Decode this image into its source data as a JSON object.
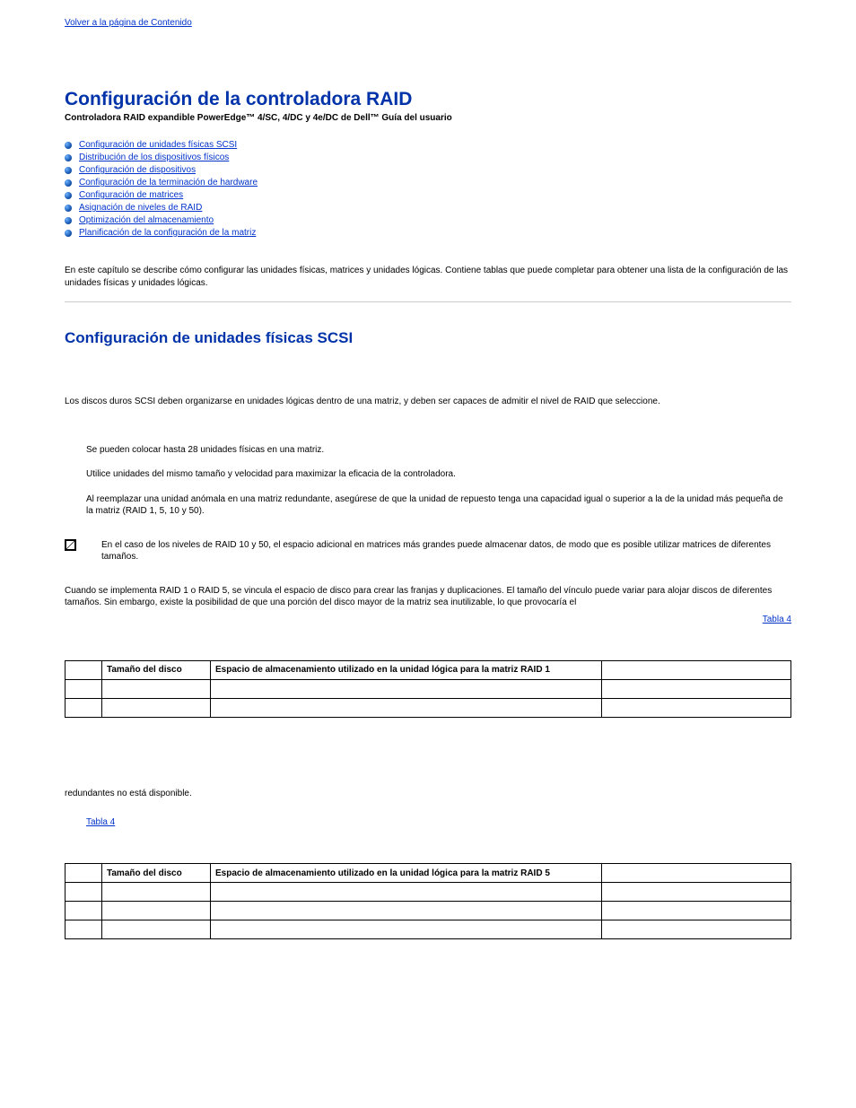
{
  "topLink": "Volver a la página de Contenido",
  "title": "Configuración de la controladora RAID",
  "subtitle": "Controladora RAID expandible PowerEdge™ 4/SC, 4/DC y 4e/DC de Dell™ Guía del usuario",
  "toc": [
    "Configuración de unidades físicas SCSI",
    "Distribución de los dispositivos físicos",
    "Configuración de dispositivos",
    "Configuración de la terminación de hardware",
    "Configuración de matrices",
    "Asignación de niveles de RAID",
    "Optimización del almacenamiento",
    "Planificación de la configuración de la matriz"
  ],
  "intro": "En este capítulo se describe cómo configurar las unidades físicas, matrices y unidades lógicas. Contiene tablas que puede completar para obtener una lista de la configuración de las unidades físicas y unidades lógicas.",
  "section1": {
    "heading": "Configuración de unidades físicas SCSI",
    "p1": "Los discos duros SCSI deben organizarse en unidades lógicas dentro de una matriz, y deben ser capaces de admitir el nivel de RAID que seleccione.",
    "bullets": [
      "Se pueden colocar hasta 28 unidades físicas en una matriz.",
      "Utilice unidades del mismo tamaño y velocidad para maximizar la eficacia de la controladora.",
      "Al reemplazar una unidad anómala en una matriz redundante, asegúrese de que la unidad de repuesto tenga una capacidad igual o superior a la de la unidad más pequeña de la matriz (RAID 1, 5, 10 y 50)."
    ],
    "note": "En el caso de los niveles de RAID 10 y 50, el espacio adicional en matrices más grandes puede almacenar datos, de modo que es posible utilizar matrices de diferentes tamaños.",
    "p2": "Cuando se implementa RAID 1 o RAID 5, se vincula el espacio de disco para crear las franjas y duplicaciones. El tamaño del vínculo puede variar para alojar discos de diferentes tamaños. Sin embargo, existe la posibilidad de que una porción del disco mayor de la matriz sea inutilizable, lo que provocaría el",
    "tableRef": "Tabla 4",
    "p3": "redundantes no está disponible.",
    "tableRef2": "Tabla 4"
  },
  "table1": {
    "headers": [
      "",
      "Tamaño del disco",
      "Espacio de almacenamiento utilizado en la unidad lógica para la matriz RAID 1",
      ""
    ],
    "rows": [
      [
        "",
        "",
        "",
        ""
      ],
      [
        "",
        "",
        "",
        ""
      ]
    ]
  },
  "table2": {
    "headers": [
      "",
      "Tamaño del disco",
      "Espacio de almacenamiento utilizado en la unidad lógica para la matriz RAID 5",
      ""
    ],
    "rows": [
      [
        "",
        "",
        "",
        ""
      ],
      [
        "",
        "",
        "",
        ""
      ],
      [
        "",
        "",
        "",
        ""
      ]
    ]
  }
}
